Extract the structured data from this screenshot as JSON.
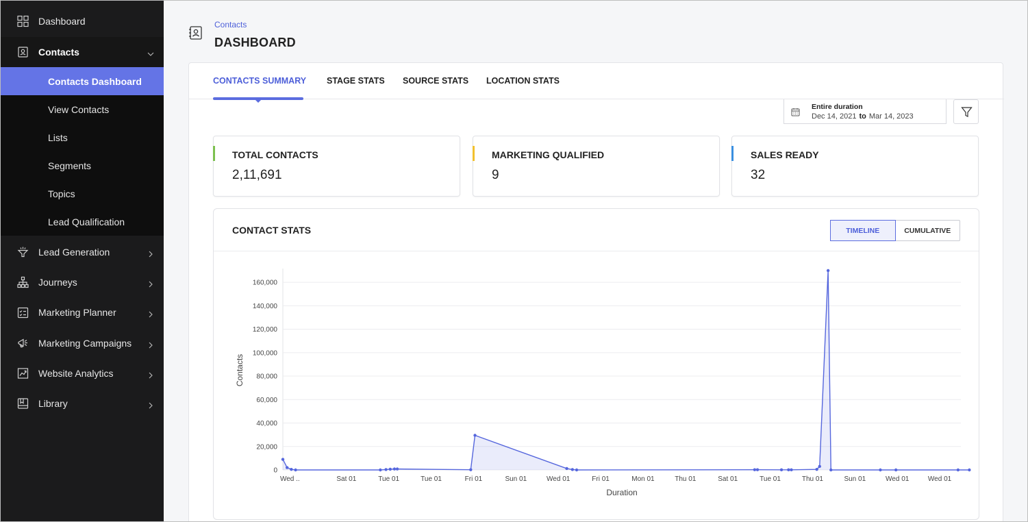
{
  "sidebar": {
    "items": [
      {
        "label": "Dashboard",
        "icon": "grid-icon",
        "chevron": ""
      },
      {
        "label": "Contacts",
        "icon": "contact-card-icon",
        "chevron": "down"
      },
      {
        "label": "Lead Generation",
        "icon": "funnel-icon",
        "chevron": "right"
      },
      {
        "label": "Journeys",
        "icon": "hierarchy-icon",
        "chevron": "right"
      },
      {
        "label": "Marketing Planner",
        "icon": "checklist-icon",
        "chevron": "right"
      },
      {
        "label": "Marketing Campaigns",
        "icon": "megaphone-icon",
        "chevron": "right"
      },
      {
        "label": "Website Analytics",
        "icon": "trend-chart-icon",
        "chevron": "right"
      },
      {
        "label": "Library",
        "icon": "book-icon",
        "chevron": "right"
      }
    ],
    "contacts_sub": [
      {
        "label": "Contacts Dashboard",
        "active": true
      },
      {
        "label": "View Contacts"
      },
      {
        "label": "Lists"
      },
      {
        "label": "Segments"
      },
      {
        "label": "Topics"
      },
      {
        "label": "Lead Qualification"
      }
    ]
  },
  "header": {
    "breadcrumb": "Contacts",
    "title": "DASHBOARD",
    "icon": "contact-card-icon"
  },
  "tabs": [
    {
      "label": "CONTACTS SUMMARY",
      "active": true
    },
    {
      "label": "STAGE STATS"
    },
    {
      "label": "SOURCE STATS"
    },
    {
      "label": "LOCATION STATS"
    }
  ],
  "date_range": {
    "label": "Entire duration",
    "from": "Dec 14, 2021",
    "sep": "to",
    "to": "Mar 14, 2023",
    "icon": "calendar-icon"
  },
  "filter": {
    "icon": "filter-icon"
  },
  "stats": [
    {
      "title": "TOTAL CONTACTS",
      "value": "2,11,691",
      "color": "#7cc04f"
    },
    {
      "title": "MARKETING QUALIFIED",
      "value": "9",
      "color": "#f2c12e"
    },
    {
      "title": "SALES READY",
      "value": "32",
      "color": "#3a8fe0"
    }
  ],
  "chart_card": {
    "title": "CONTACT STATS",
    "toggle": {
      "timeline": "TIMELINE",
      "cumulative": "CUMULATIVE",
      "selected": "timeline"
    }
  },
  "chart_data": {
    "type": "area",
    "title": "",
    "xlabel": "Duration",
    "ylabel": "Contacts",
    "ylim": [
      0,
      170000
    ],
    "yticks": [
      0,
      20000,
      40000,
      60000,
      80000,
      100000,
      120000,
      140000,
      160000
    ],
    "ytick_labels": [
      "0",
      "20,000",
      "40,000",
      "60,000",
      "80,000",
      "100,000",
      "120,000",
      "140,000",
      "160,000"
    ],
    "xtick_labels": [
      "Wed ..",
      "Sat 01",
      "Tue 01",
      "Tue 01",
      "Fri 01",
      "Sun 01",
      "Wed 01",
      "Fri 01",
      "Mon 01",
      "Thu 01",
      "Sat 01",
      "Tue 01",
      "Thu 01",
      "Sun 01",
      "Wed 01",
      "Wed 01"
    ],
    "color": "#5566dd",
    "grid": true,
    "series": [
      {
        "points": [
          [
            0.0,
            9000
          ],
          [
            0.3,
            2000
          ],
          [
            0.6,
            500
          ],
          [
            0.9,
            0
          ],
          [
            6.9,
            0
          ],
          [
            7.3,
            300
          ],
          [
            7.6,
            600
          ],
          [
            7.9,
            800
          ],
          [
            8.1,
            800
          ],
          [
            13.3,
            200
          ],
          [
            13.6,
            29500
          ],
          [
            20.1,
            1200
          ],
          [
            20.5,
            300
          ],
          [
            20.8,
            0
          ],
          [
            33.4,
            200
          ],
          [
            33.6,
            200
          ],
          [
            35.3,
            100
          ],
          [
            35.8,
            100
          ],
          [
            36.0,
            100
          ],
          [
            37.8,
            500
          ],
          [
            38.0,
            3000
          ],
          [
            38.6,
            170000
          ],
          [
            38.8,
            0
          ],
          [
            42.3,
            0
          ],
          [
            43.4,
            0
          ],
          [
            47.8,
            0
          ],
          [
            48.6,
            0
          ]
        ]
      }
    ]
  }
}
